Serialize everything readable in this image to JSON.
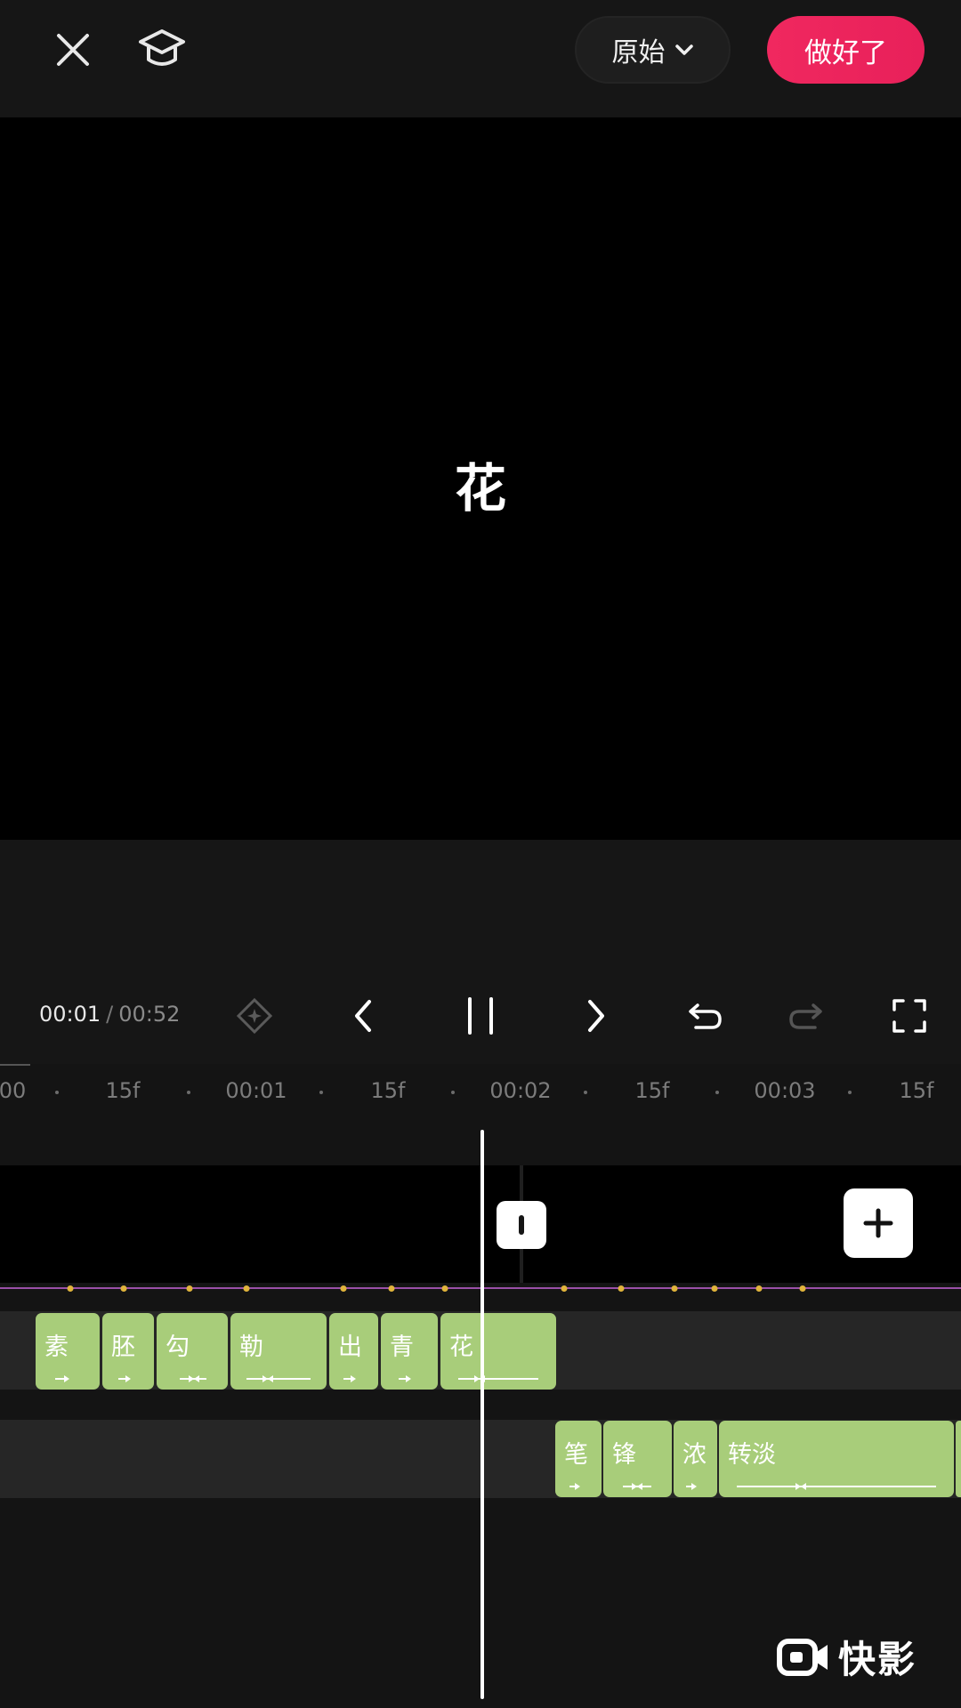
{
  "topbar": {
    "ratio_label": "原始",
    "done_label": "做好了"
  },
  "preview": {
    "text": "花"
  },
  "playback": {
    "current_time": "00:01",
    "separator": "/",
    "total_time": "00:52"
  },
  "ruler": {
    "ticks": [
      "00",
      "15f",
      "00:01",
      "15f",
      "00:02",
      "15f",
      "00:03",
      "15f"
    ]
  },
  "text_track_1": {
    "clips": [
      "素",
      "胚",
      "勾",
      "勒",
      "出",
      "青",
      "花"
    ]
  },
  "text_track_2": {
    "clips": [
      "笔",
      "锋",
      "浓",
      "转淡"
    ]
  },
  "watermark": {
    "text": "快影"
  },
  "colors": {
    "accent": "#e8205a",
    "clip": "#a8cd7a",
    "keyframe_dot": "#e1b43c",
    "audio_line": "#9a4fa8"
  }
}
